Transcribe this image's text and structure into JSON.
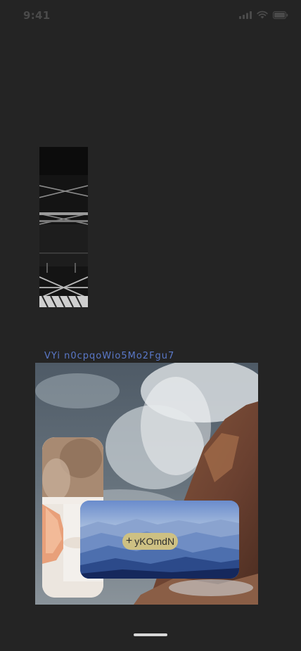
{
  "status_bar": {
    "time": "9:41",
    "signal_icon": "cellular-signal-icon",
    "wifi_icon": "wifi-icon",
    "battery_icon": "battery-icon"
  },
  "caption": {
    "text": "VYi n0cpqoWio5Mo2Fgu7",
    "color": "#5a78c8"
  },
  "images": {
    "bridge": "bridge-photo",
    "ocean": "ocean-waves-rocks-photo",
    "portrait": "hand-with-glass-photo",
    "mountains": "misty-mountains-photo"
  },
  "action_button": {
    "icon": "plus-icon",
    "plus_glyph": "+",
    "label": "yKOmdN",
    "color": "#cdc083"
  }
}
